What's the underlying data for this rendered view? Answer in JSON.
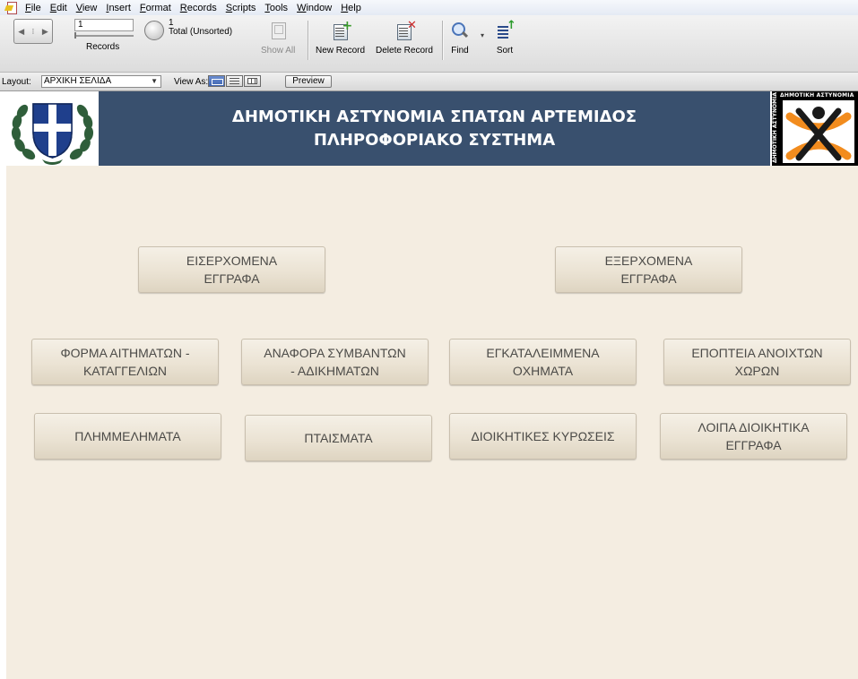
{
  "menu": {
    "items": [
      "File",
      "Edit",
      "View",
      "Insert",
      "Format",
      "Records",
      "Scripts",
      "Tools",
      "Window",
      "Help"
    ]
  },
  "toolbar": {
    "record_value": "1",
    "records_label": "Records",
    "found_count": "1",
    "found_label": "Total (Unsorted)",
    "show_all_label": "Show All",
    "new_record_label": "New Record",
    "delete_record_label": "Delete Record",
    "find_label": "Find",
    "sort_label": "Sort"
  },
  "layoutbar": {
    "layout_label": "Layout:",
    "layout_value": "ΑΡΧΙΚΗ ΣΕΛΙΔΑ",
    "view_as_label": "View As:",
    "preview_label": "Preview"
  },
  "header": {
    "title": "ΔΗΜΟΤΙΚΗ ΑΣΤΥΝΟΜΙΑ ΣΠΑΤΩΝ ΑΡΤΕΜΙΔΟΣ",
    "subtitle": "ΠΛΗΡΟΦΟΡΙΑΚΟ ΣΥΣΤΗΜΑ",
    "logo_text_top": "ΔΗΜΟΤΙΚΗ ΑΣΤΥΝΟΜΙΑ",
    "logo_text_side": "ΔΗΜΟΤΙΚΗ ΑΣΤΥΝΟΜΙΑ"
  },
  "buttons": {
    "incoming": "ΕΙΣΕΡΧΟΜΕΝΑ\nΕΓΓΡΑΦΑ",
    "outgoing": "ΕΞΕΡΧΟΜΕΝΑ\nΕΓΓΡΑΦΑ",
    "requests": "ΦΟΡΜΑ ΑΙΤΗΜΑΤΩΝ -\nΚΑΤΑΓΓΕΛΙΩΝ",
    "incidents": "ΑΝΑΦΟΡΑ ΣΥΜΒΑΝΤΩΝ\n- ΑΔΙΚΗΜΑΤΩΝ",
    "abandoned": "ΕΓΚΑΤΑΛΕΙΜΜΕΝΑ\nΟΧΗΜΑΤΑ",
    "open_spaces": "ΕΠΟΠΤΕΙΑ ΑΝΟΙΧΤΩΝ\nΧΩΡΩΝ",
    "misdemeanors": "ΠΛΗΜΜΕΛΗΜΑΤΑ",
    "violations": "ΠΤΑΙΣΜΑΤΑ",
    "sanctions": "ΔΙΟΙΚΗΤΙΚΕΣ ΚΥΡΩΣΕΙΣ",
    "other_docs": "ΛΟΙΠΑ ΔΙΟΙΚΗΤΙΚΑ\nΕΓΓΡΑΦΑ"
  },
  "colors": {
    "header_band": "#39506e",
    "content_bg": "#f4ede1",
    "button_text": "#4b4a47",
    "logo_accent": "#f28c1e"
  }
}
